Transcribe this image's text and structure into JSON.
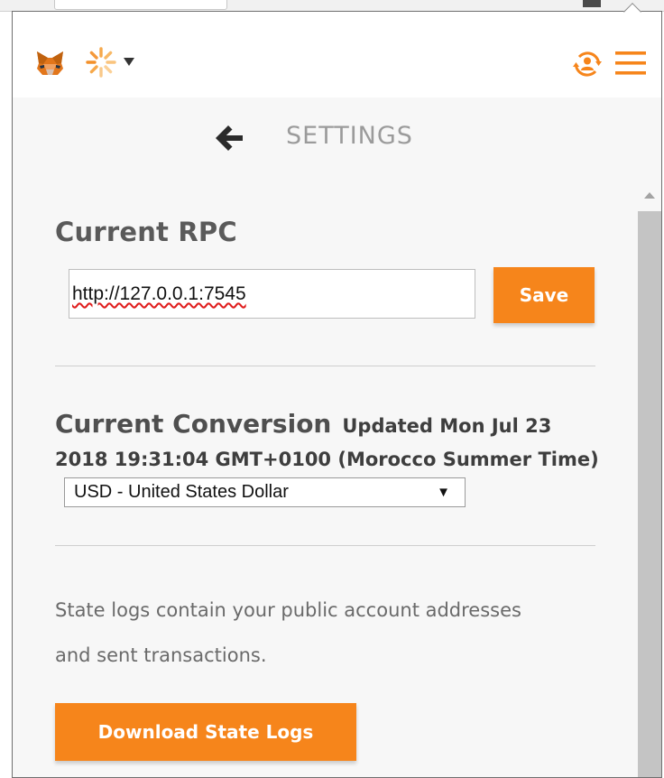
{
  "header": {
    "logo_icon": "metamask-fox-icon",
    "network_icon": "network-spinner-icon",
    "account_icon": "account-sync-icon",
    "menu_icon": "hamburger-menu-icon",
    "accent_color": "#f6851b"
  },
  "settings": {
    "title": "SETTINGS",
    "back_icon": "back-arrow-icon"
  },
  "rpc": {
    "heading": "Current RPC",
    "value": "http://127.0.0.1:7545",
    "save_label": "Save"
  },
  "conversion": {
    "heading": "Current Conversion",
    "updated_text": "Updated Mon Jul 23 2018 19:31:04 GMT+0100 (Morocco Summer Time)",
    "selected_currency": "USD - United States Dollar"
  },
  "logs": {
    "description": "State logs contain your public account addresses and sent transactions.",
    "download_label": "Download State Logs"
  }
}
